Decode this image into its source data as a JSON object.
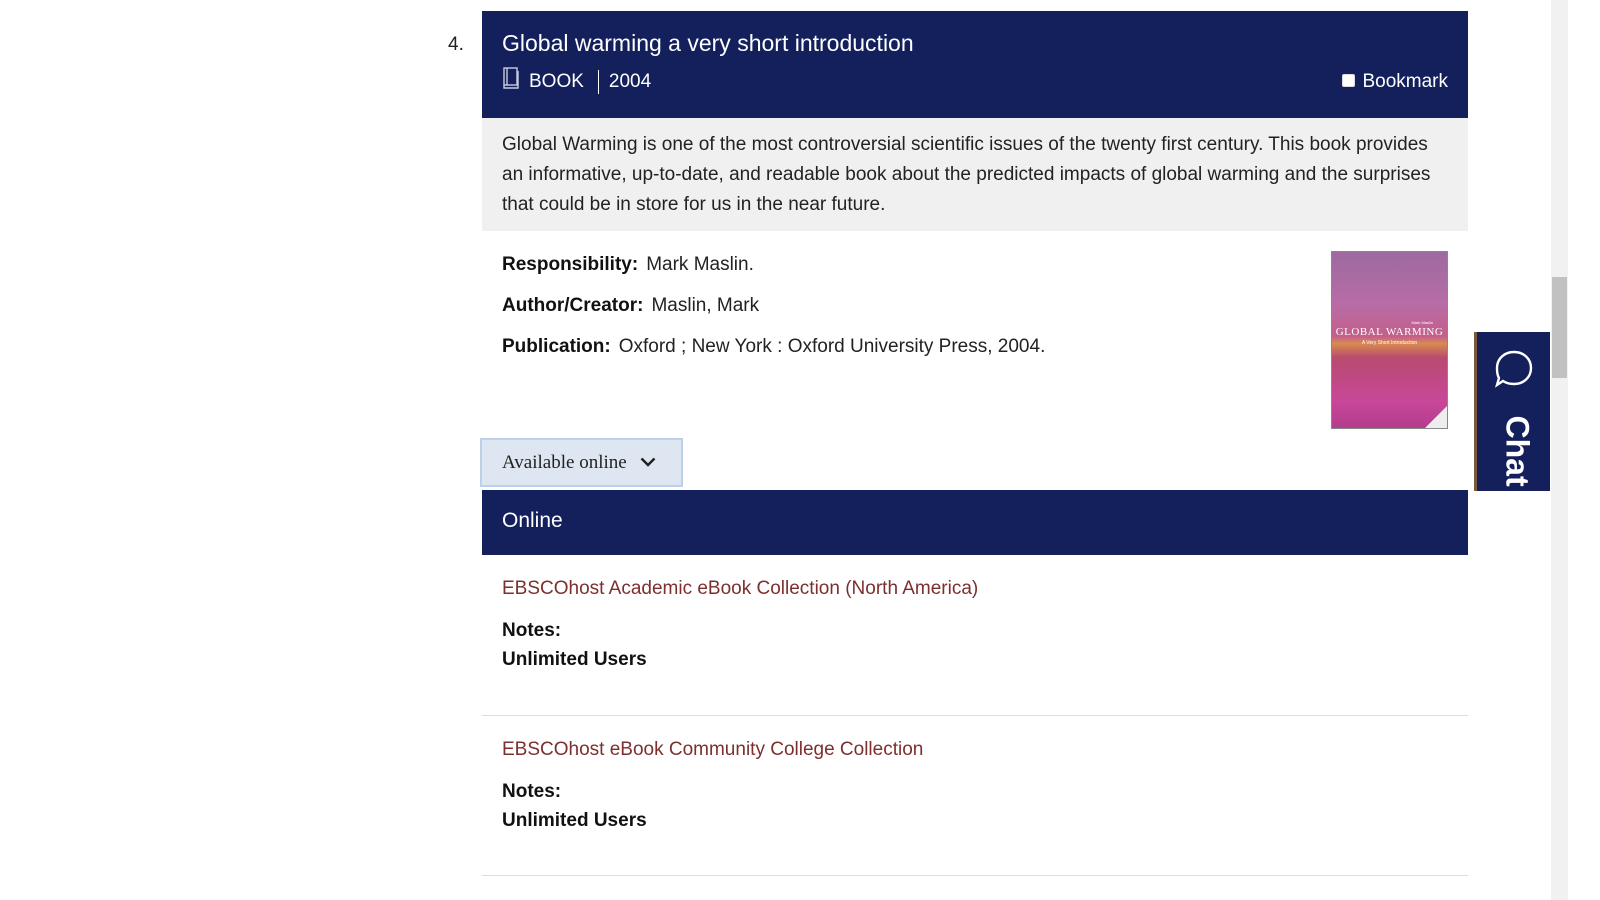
{
  "result": {
    "number": "4.",
    "title": "Global warming a very short introduction",
    "type_label": "BOOK",
    "year": "2004",
    "bookmark_label": "Bookmark",
    "description": "Global Warming is one of the most controversial scientific issues of the twenty first century. This book provides an informative, up-to-date, and readable book about the predicted impacts of global warming and the surprises that could be in store for us in the near future.",
    "fields": [
      {
        "label": "Responsibility:",
        "value": "Mark Maslin."
      },
      {
        "label": "Author/Creator:",
        "value": "Maslin, Mark"
      },
      {
        "label": "Publication:",
        "value": "Oxford ; New York : Oxford University Press, 2004."
      }
    ],
    "cover": {
      "title_text": "GLOBAL WARMING",
      "subtitle_text": "A Very Short Introduction",
      "author_text": "Mark Maslin"
    }
  },
  "availability": {
    "button_label": "Available online",
    "section_title": "Online",
    "links": [
      {
        "label": "EBSCOhost Academic eBook Collection (North America)",
        "notes_label": "Notes:",
        "notes_value": "Unlimited Users"
      },
      {
        "label": "EBSCOhost eBook Community College Collection",
        "notes_label": "Notes:",
        "notes_value": "Unlimited Users"
      }
    ]
  },
  "chat": {
    "label": "Chat"
  },
  "colors": {
    "navy": "#13205c",
    "link": "#7d2f2f",
    "description_bg": "#f0f0f0",
    "button_bg": "#dde6f1"
  }
}
